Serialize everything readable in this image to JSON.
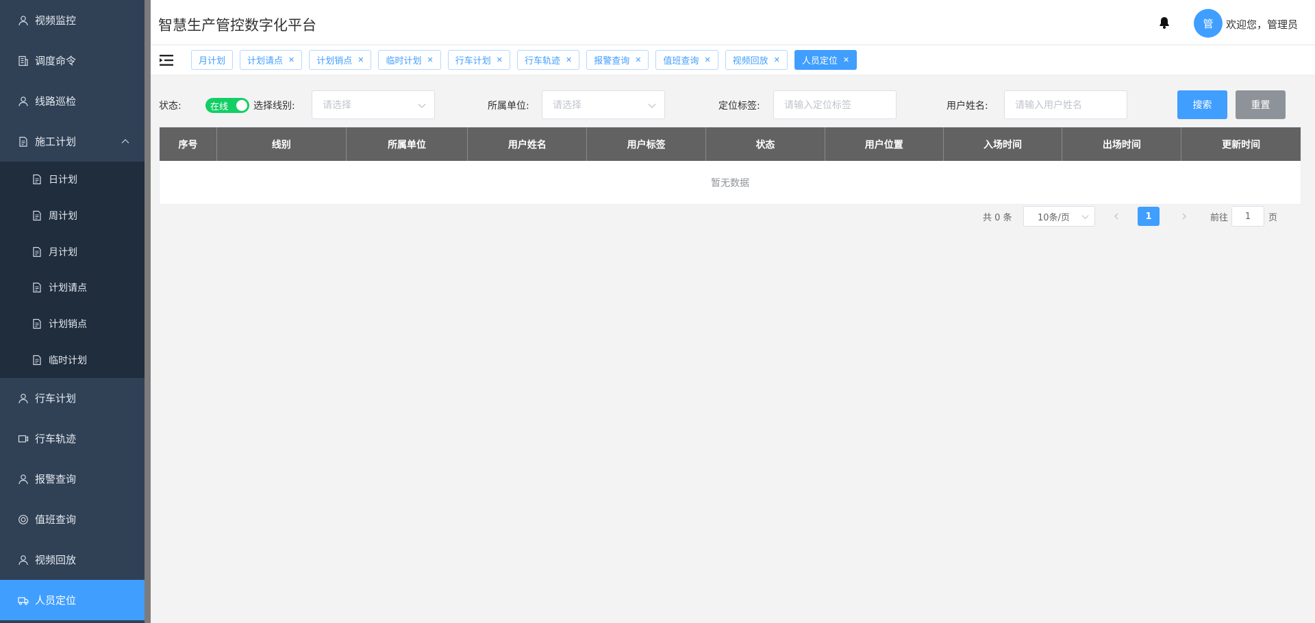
{
  "app": {
    "title": "智慧生产管控数字化平台"
  },
  "user": {
    "avatar_text": "管",
    "welcome": "欢迎您，管理员"
  },
  "sidebar": {
    "items_top": [
      {
        "label": "视频监控",
        "icon": "user-icon"
      },
      {
        "label": "调度命令",
        "icon": "building-icon"
      },
      {
        "label": "线路巡检",
        "icon": "user-icon"
      }
    ],
    "group": {
      "label": "施工计划",
      "icon": "document-icon",
      "expanded": true,
      "children": [
        "日计划",
        "周计划",
        "月计划",
        "计划请点",
        "计划销点",
        "临时计划"
      ]
    },
    "items_bottom": [
      {
        "label": "行车计划",
        "icon": "user-icon"
      },
      {
        "label": "行车轨迹",
        "icon": "camera-icon"
      },
      {
        "label": "报警查询",
        "icon": "user-icon"
      },
      {
        "label": "值班查询",
        "icon": "lifebuoy-icon"
      },
      {
        "label": "视频回放",
        "icon": "user-icon"
      },
      {
        "label": "人员定位",
        "icon": "truck-icon",
        "active": true
      }
    ],
    "colors": {
      "bg": "#304156",
      "submenu_bg": "#1f2d3d",
      "active": "#409eff"
    }
  },
  "tags": [
    "月计划",
    "计划请点",
    "计划销点",
    "临时计划",
    "行车计划",
    "行车轨迹",
    "报警查询",
    "值班查询",
    "视频回放",
    "人员定位"
  ],
  "active_tag": "人员定位",
  "filter": {
    "status_label": "状态:",
    "status_value": "在线",
    "line_label": "选择线别:",
    "line_placeholder": "请选择",
    "unit_label": "所属单位:",
    "unit_placeholder": "请选择",
    "tag_label": "定位标签:",
    "tag_placeholder": "请输入定位标签",
    "name_label": "用户姓名:",
    "name_placeholder": "请输入用户姓名",
    "search_label": "搜索",
    "reset_label": "重置"
  },
  "table": {
    "columns": [
      "序号",
      "线别",
      "所属单位",
      "用户姓名",
      "用户标签",
      "状态",
      "用户位置",
      "入场时间",
      "出场时间",
      "更新时间"
    ],
    "rows": [],
    "empty_text": "暂无数据"
  },
  "pagination": {
    "total_text": "共 0 条",
    "page_size": "10条/页",
    "current_page": "1",
    "goto_label": "前往",
    "goto_value": "1",
    "page_suffix": "页"
  }
}
